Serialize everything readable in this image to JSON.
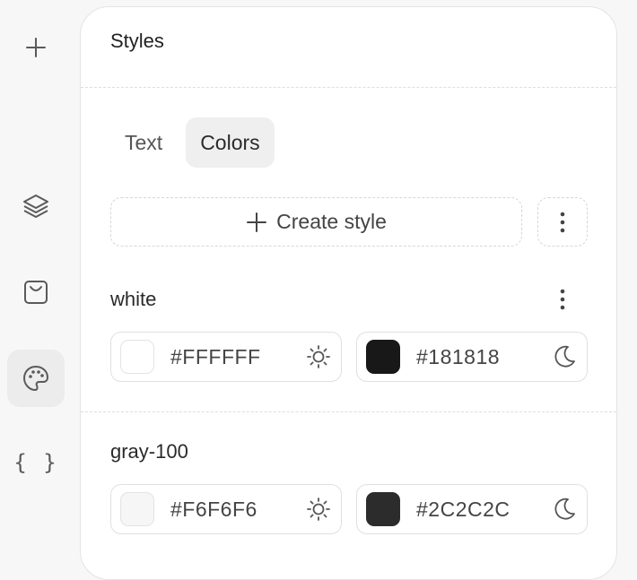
{
  "rail": {
    "items": [
      {
        "icon": "plus-icon",
        "active": false
      },
      {
        "icon": "layers-icon",
        "active": false
      },
      {
        "icon": "component-icon",
        "active": false
      },
      {
        "icon": "palette-icon",
        "active": true
      },
      {
        "icon": "braces-icon",
        "label": "{ }",
        "active": false
      }
    ]
  },
  "panel": {
    "title": "Styles",
    "tabs": [
      {
        "label": "Text",
        "active": false
      },
      {
        "label": "Colors",
        "active": true
      }
    ],
    "create_label": "Create style",
    "styles": [
      {
        "name": "white",
        "light": {
          "hex": "#FFFFFF",
          "swatch": "#FFFFFF",
          "icon": "sun-icon"
        },
        "dark": {
          "hex": "#181818",
          "swatch": "#181818",
          "icon": "moon-icon"
        }
      },
      {
        "name": "gray-100",
        "light": {
          "hex": "#F6F6F6",
          "swatch": "#F6F6F6",
          "icon": "sun-icon"
        },
        "dark": {
          "hex": "#2C2C2C",
          "swatch": "#2C2C2C",
          "icon": "moon-icon"
        }
      }
    ]
  },
  "colors": {
    "background": "#f7f7f7",
    "panel": "#ffffff",
    "active_tab": "#efefef",
    "active_rail": "#ececec",
    "icon": "#5a5a5a"
  }
}
